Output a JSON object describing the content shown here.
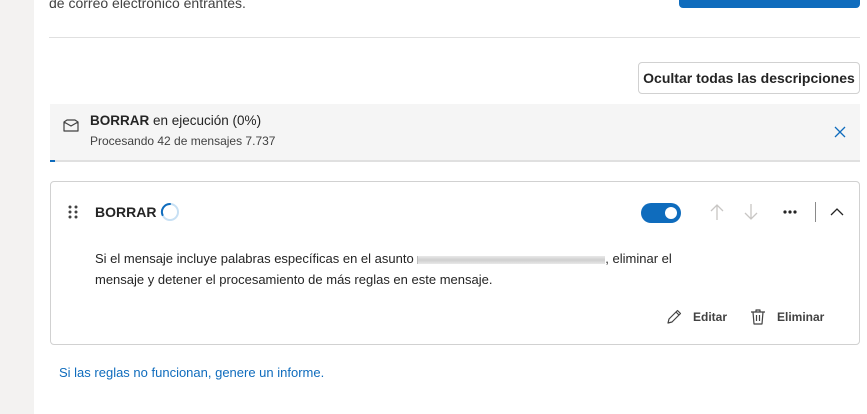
{
  "header": {
    "partial_text": "de correo electrónico entrantes."
  },
  "toolbar": {
    "hide_descriptions_label": "Ocultar todas las descripciones"
  },
  "progress": {
    "rule_name": "BORRAR",
    "status_text": " en ejecución (0%)",
    "detail": "Procesando 42 de mensajes 7.737",
    "fraction": 0.006
  },
  "rule": {
    "name": "BORRAR",
    "enabled": true,
    "description_before": "Si el mensaje incluye palabras específicas en el asunto ",
    "description_after": ", eliminar el mensaje y detener el procesamiento de más reglas en este mensaje.",
    "edit_label": "Editar",
    "delete_label": "Eliminar"
  },
  "footer": {
    "report_link": "Si las reglas no funcionan, genere un informe."
  },
  "colors": {
    "accent": "#0f6cbd"
  }
}
